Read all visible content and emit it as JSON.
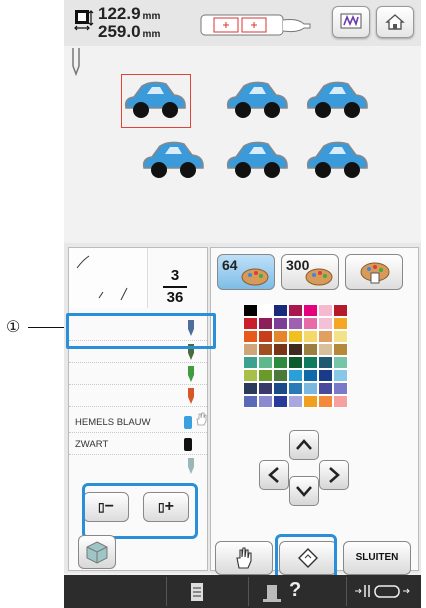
{
  "callout": {
    "marker": "①"
  },
  "top": {
    "width_value": "122.9",
    "width_unit": "mm",
    "height_value": "259.0",
    "height_unit": "mm"
  },
  "thread_panel": {
    "counter_current": "3",
    "counter_total": "36",
    "rows": [
      {
        "label": "",
        "color": "#4d6e9b"
      },
      {
        "label": "",
        "color": "#4a6b3a"
      },
      {
        "label": "",
        "color": "#3f9c3f"
      },
      {
        "label": "",
        "color": "#d8572a"
      },
      {
        "label": "HEMELS BLAUW",
        "color": "#3aa0e0"
      },
      {
        "label": "ZWART",
        "color": "#111111"
      },
      {
        "label": "",
        "color": "#9ab7b7"
      }
    ]
  },
  "tabs": [
    {
      "label": "64",
      "active": true
    },
    {
      "label": "300",
      "active": false
    },
    {
      "label": "",
      "active": false
    }
  ],
  "palette_colors": [
    [
      "#000000",
      "#ffffff",
      "#1a2a7a",
      "#a8174e",
      "#e5007e",
      "#f7b9d0",
      "#b51a2a"
    ],
    [
      "#c9202c",
      "#8c1e5a",
      "#7c3f98",
      "#a060b0",
      "#e86aa8",
      "#f4c0d8",
      "#f5a623"
    ],
    [
      "#e85a1a",
      "#c73f16",
      "#e5862e",
      "#f0c020",
      "#f5d86a",
      "#e0a060",
      "#f3e28a"
    ],
    [
      "#cfa67a",
      "#a05020",
      "#7a3416",
      "#3f2a1e",
      "#9a7f3e",
      "#d8c09a",
      "#b48a3a"
    ],
    [
      "#3ea08f",
      "#5fb88a",
      "#2e8a3e",
      "#0d5a2e",
      "#0f7a5e",
      "#1e5a70",
      "#77c4a8"
    ],
    [
      "#a8c04a",
      "#6a9a2a",
      "#4a7a3a",
      "#2a9fd8",
      "#0e6aa8",
      "#1a3a8a",
      "#87c8e8"
    ],
    [
      "#2a3a5a",
      "#3a3a6a",
      "#1a4a8a",
      "#2a7ab8",
      "#7ab8e0",
      "#4a4a9a",
      "#7a7ac8"
    ],
    [
      "#5a6ab8",
      "#8a8ad0",
      "#2a3a9a",
      "#a8a8e0",
      "#f0a020",
      "#f28a3a",
      "#f6a0a0"
    ]
  ],
  "buttons": {
    "thread_minus": "−",
    "thread_plus": "+",
    "close": "SLUITEN"
  },
  "bottombar": {
    "help": "?"
  }
}
